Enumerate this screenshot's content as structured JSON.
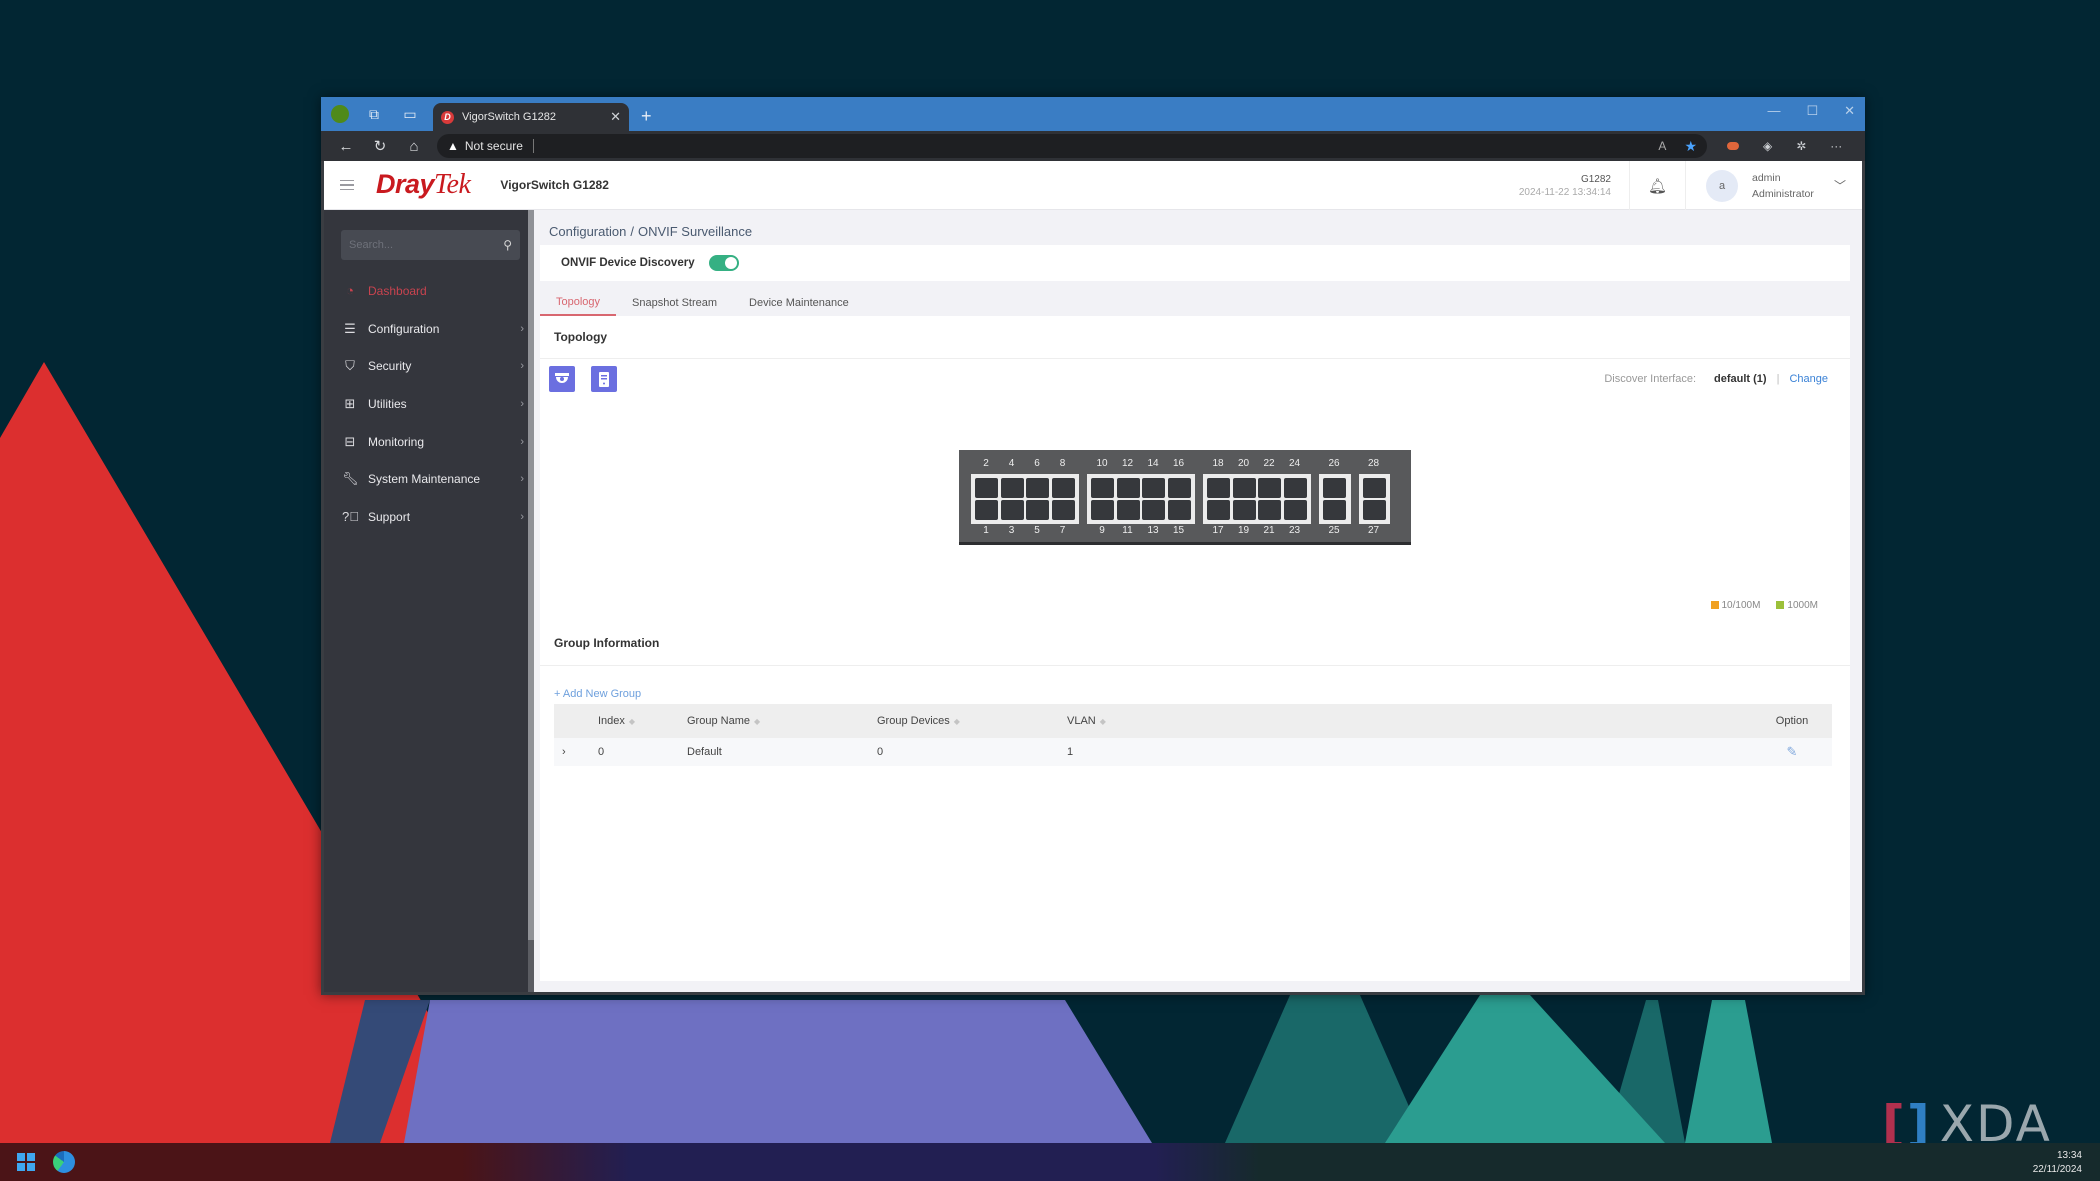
{
  "browser": {
    "tab_title": "VigorSwitch G1282",
    "tab_favicon": "D",
    "address_security": "Not secure",
    "address_url": "",
    "window_controls": [
      "minimize",
      "maximize",
      "close"
    ]
  },
  "header": {
    "logo_bold": "Dray",
    "logo_light": "Tek",
    "model": "VigorSwitch G1282",
    "device_name": "G1282",
    "device_time": "2024-11-22 13:34:14",
    "user_initial": "a",
    "user_name": "admin",
    "user_role": "Administrator"
  },
  "sidebar": {
    "search_placeholder": "Search...",
    "items": [
      {
        "label": "Dashboard",
        "icon": "gauge-icon",
        "active": true,
        "has_children": false
      },
      {
        "label": "Configuration",
        "icon": "sliders-icon",
        "active": false,
        "has_children": true
      },
      {
        "label": "Security",
        "icon": "shield-check-icon",
        "active": false,
        "has_children": true
      },
      {
        "label": "Utilities",
        "icon": "apps-icon",
        "active": false,
        "has_children": true
      },
      {
        "label": "Monitoring",
        "icon": "monitor-icon",
        "active": false,
        "has_children": true
      },
      {
        "label": "System Maintenance",
        "icon": "wrench-icon",
        "active": false,
        "has_children": true
      },
      {
        "label": "Support",
        "icon": "help-circle-icon",
        "active": false,
        "has_children": true
      }
    ]
  },
  "breadcrumb": {
    "parent": "Configuration",
    "separator": "/",
    "current": "ONVIF Surveillance"
  },
  "discovery": {
    "label": "ONVIF Device Discovery",
    "enabled": true
  },
  "tabs": [
    {
      "label": "Topology",
      "active": true
    },
    {
      "label": "Snapshot Stream",
      "active": false
    },
    {
      "label": "Device Maintenance",
      "active": false
    }
  ],
  "topology": {
    "title": "Topology",
    "tool_buttons": [
      "camera-icon",
      "server-icon"
    ],
    "discover_label": "Discover Interface:",
    "discover_value": "default (1)",
    "discover_sep": "|",
    "change_label": "Change",
    "port_groups": [
      {
        "top": [
          "2",
          "4",
          "6",
          "8"
        ],
        "bottom": [
          "1",
          "3",
          "5",
          "7"
        ]
      },
      {
        "top": [
          "10",
          "12",
          "14",
          "16"
        ],
        "bottom": [
          "9",
          "11",
          "13",
          "15"
        ]
      },
      {
        "top": [
          "18",
          "20",
          "22",
          "24"
        ],
        "bottom": [
          "17",
          "19",
          "21",
          "23"
        ]
      },
      {
        "top": [
          "26"
        ],
        "bottom": [
          "25"
        ]
      },
      {
        "top": [
          "28"
        ],
        "bottom": [
          "27"
        ]
      }
    ],
    "legend": [
      {
        "label": "10/100M",
        "color": "#f0a020"
      },
      {
        "label": "1000M",
        "color": "#9cc03a"
      }
    ]
  },
  "group_info": {
    "title": "Group Information",
    "add_label": "+ Add New Group",
    "columns": [
      "Index",
      "Group Name",
      "Group Devices",
      "VLAN",
      "Option"
    ],
    "rows": [
      {
        "index": "0",
        "name": "Default",
        "devices": "0",
        "vlan": "1"
      }
    ]
  },
  "taskbar": {
    "time": "13:34",
    "date": "22/11/2024"
  },
  "watermark": {
    "text": "XDA"
  },
  "colors": {
    "brand_red": "#c91a1f",
    "toggle_on": "#35b083",
    "tab_active": "#d86770",
    "tool_button": "#6b6fe0",
    "link": "#3b82d6"
  }
}
